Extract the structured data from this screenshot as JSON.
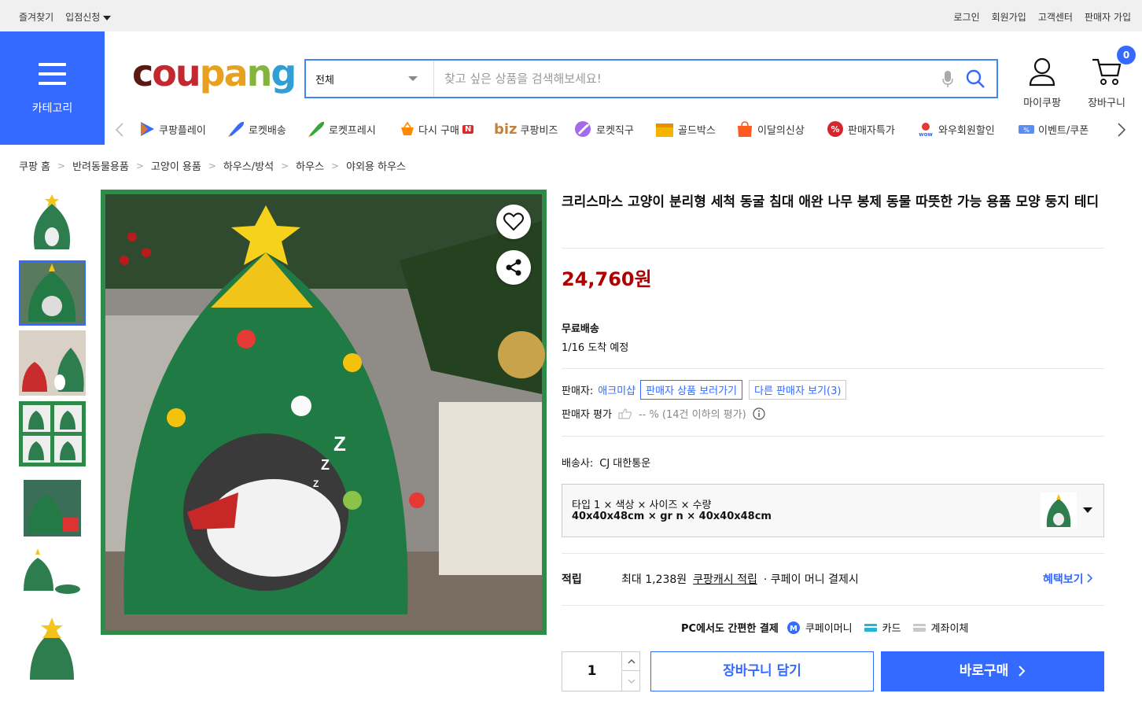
{
  "topbar": {
    "bookmark": "즐겨찾기",
    "join_store": "입점신청",
    "login": "로그인",
    "signup": "회원가입",
    "support": "고객센터",
    "seller_signup": "판매자 가입"
  },
  "header": {
    "category_label": "카테고리",
    "logo": [
      "c",
      "ou",
      "pa",
      "n",
      "g"
    ],
    "search": {
      "category": "전체",
      "placeholder": "찾고 싶은 상품을 검색해보세요!"
    },
    "my_coupang": "마이쿠팡",
    "cart": "장바구니",
    "cart_count": "0"
  },
  "gnb": [
    "쿠팡플레이",
    "로켓배송",
    "로켓프레시",
    "다시 구매",
    "쿠팡비즈",
    "로켓직구",
    "골드박스",
    "이달의신상",
    "판매자특가",
    "와우회원할인",
    "이벤트/쿠폰"
  ],
  "gnb_biz_prefix": "biz",
  "breadcrumb": [
    "쿠팡 홈",
    "반려동물용품",
    "고양이 용품",
    "하우스/방석",
    "하우스",
    "야외용 하우스"
  ],
  "product": {
    "title": "크리스마스 고양이 분리형 세척 동굴 침대 애완 나무 봉제 동물 따뜻한 가능 용품 모양 둥지 테디",
    "price": "24,760원",
    "shipping_label": "무료배송",
    "arrival": "1/16 도착 예정",
    "seller_label": "판매자:",
    "seller_name": "애크미샵",
    "seller_products_btn": "판매자 상품 보러가기",
    "other_sellers_btn": "다른 판매자 보기(3)",
    "seller_rating_label": "판매자 평가",
    "seller_rating_value": "-- % (14건 이하의 평가)",
    "courier_label": "배송사:",
    "courier_name": "CJ 대한통운",
    "option_header": "타입 1 × 색상 × 사이즈 × 수량",
    "option_value": "40x40x48cm × gr n × 40x40x48cm",
    "reward_label": "적립",
    "reward_amount": "최대 1,238원",
    "reward_link": "쿠팡캐시 적립",
    "reward_condition": "· 쿠페이 머니 결제시",
    "benefit_link": "혜택보기",
    "pay_label": "PC에서도 간편한 결제",
    "pay_money": "쿠페이머니",
    "pay_card": "카드",
    "pay_transfer": "계좌이체",
    "quantity": "1",
    "add_to_cart": "장바구니 담기",
    "buy_now": "바로구매"
  },
  "colors": {
    "accent": "#346aff",
    "price": "#ae0000",
    "tree_green": "#2e8b4a"
  }
}
